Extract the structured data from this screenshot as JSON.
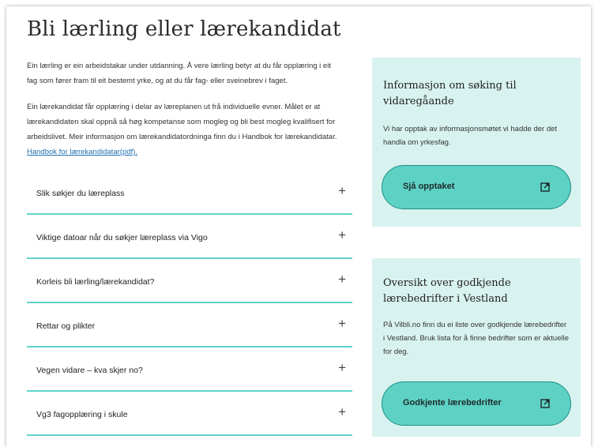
{
  "page": {
    "title": "Bli lærling eller lærekandidat",
    "intro": {
      "p1": "Ein lærling er ein arbeidstakar under utdanning. Å vere lærling betyr at du får opplæring i eit fag som fører fram til eit bestemt yrke, og at du får fag- eller sveinebrev i faget.",
      "p2": "Ein lærekandidat får opplæring i delar av læreplanen ut frå individuelle evner. Målet er at lærekandidaten skal oppnå så høg kompetanse som mogleg og bli best mogleg kvalifisert for arbeidslivet. Meir informasjon om lærekandidatordninga finn du i Handbok for lærekandidatar. ",
      "link": "Handbok for lærekandidatar(pdf)."
    }
  },
  "accordion": {
    "items": [
      {
        "label": "Slik søkjer du læreplass"
      },
      {
        "label": "Viktige datoar når du søkjer læreplass via Vigo"
      },
      {
        "label": "Korleis bli lærling/lærekandidat?"
      },
      {
        "label": "Rettar og plikter"
      },
      {
        "label": "Vegen vidare – kva skjer no?"
      },
      {
        "label": "Vg3 fagopplæring i skule"
      }
    ],
    "expand_symbol": "+"
  },
  "cards": [
    {
      "title": "Informasjon om søking til vidaregåande",
      "text": "Vi har opptak av informasjonsmøtet vi hadde der det handla om yrkesfag.",
      "button": "Sjå opptaket",
      "icon": "external-link-icon"
    },
    {
      "title": "Oversikt over godkjende lærebedrifter i Vestland",
      "text": "På Vilbli.no finn du ei liste over godkjende lærebedrifter i Vestland. Bruk lista for å finne bedrifter som er aktuelle for deg.",
      "button": "Godkjente lærebedrifter",
      "icon": "external-link-icon"
    }
  ],
  "colors": {
    "accent": "#5ed4c8",
    "card_bg": "#d8f3ef",
    "button_bg": "#5ed1c5",
    "link": "#1f6fb2"
  }
}
